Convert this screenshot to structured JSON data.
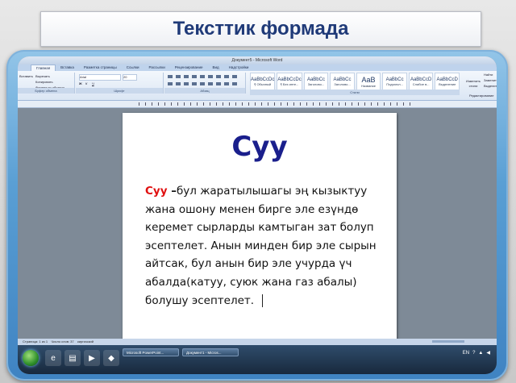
{
  "slide": {
    "title": "Тексттик формада"
  },
  "window": {
    "title": "Документ5 - Microsoft Word"
  },
  "ribbon": {
    "tabs": [
      "Главная",
      "Вставка",
      "Разметка страницы",
      "Ссылки",
      "Рассылки",
      "Рецензирование",
      "Вид",
      "Надстройки"
    ],
    "active_tab": "Главная",
    "clipboard": {
      "paste_label": "Вставить",
      "cut_label": "Вырезать",
      "copy_label": "Копировать",
      "format_label": "Формат по образцу",
      "group_label": "Буфер обмена"
    },
    "font": {
      "font_name": "Arial",
      "font_size": "20",
      "group_label": "Шрифт"
    },
    "paragraph": {
      "group_label": "Абзац"
    },
    "styles": {
      "items": [
        {
          "sample": "AaBbCcDc",
          "name": "¶ Обычный"
        },
        {
          "sample": "AaBbCcDc",
          "name": "¶ Без инте..."
        },
        {
          "sample": "AaBbCc",
          "name": "Заголово..."
        },
        {
          "sample": "AaBbCc",
          "name": "Заголово..."
        },
        {
          "sample": "AaB",
          "name": "Название"
        },
        {
          "sample": "AaBbCc",
          "name": "Подзагол..."
        },
        {
          "sample": "AaBbCcD",
          "name": "Слабое в..."
        },
        {
          "sample": "AaBbCcD",
          "name": "Выделение"
        }
      ],
      "change_styles_label": "Изменить стили",
      "group_label": "Стили"
    },
    "editing": {
      "find_label": "Найти",
      "replace_label": "Заменить",
      "select_label": "Выделить",
      "group_label": "Редактирование"
    }
  },
  "document": {
    "heading": "Суу",
    "para_lead": "Суу",
    "para_dash": " –",
    "para_text": "бул жаратылышагы эң кызыктуу жана ошону менен бирге эле езүндө керемет сырларды камтыган зат болуп эсептелет. Анын минден бир эле сырын айтсак, бул анын бир эле учурда үч абалда(катуу, суюк жана газ абалы) болушу эсептелет."
  },
  "statusbar": {
    "page": "Страница: 1 из 1",
    "words": "Число слов: 37",
    "lang": "киргизский"
  },
  "taskbar": {
    "apps": [
      "Microsoft PowerPoint...",
      "Документ1 - Micros..."
    ],
    "lang": "EN",
    "time": ""
  }
}
